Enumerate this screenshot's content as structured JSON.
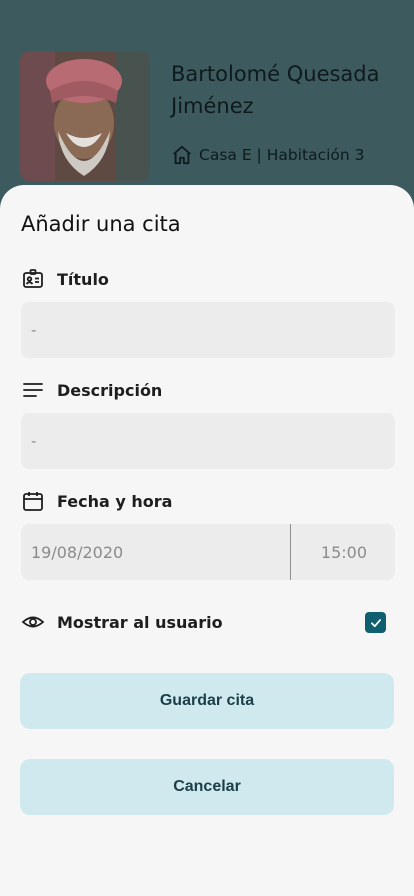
{
  "resident": {
    "name": "Bartolomé Quesada Jiménez",
    "location": "Casa E | Habitación 3"
  },
  "sheet": {
    "title": "Añadir una cita"
  },
  "form": {
    "title_label": "Título",
    "title_value": "-",
    "description_label": "Descripción",
    "description_value": "-",
    "datetime_label": "Fecha y hora",
    "date_value": "19/08/2020",
    "time_value": "15:00",
    "show_user_label": "Mostrar al usuario",
    "show_user_checked": true
  },
  "buttons": {
    "save": "Guardar cita",
    "cancel": "Cancelar"
  },
  "colors": {
    "accent": "#0f5f70",
    "button_bg": "#cfe9ef",
    "overlay": "#3d5a5f"
  },
  "icons": [
    "home-icon",
    "id-card-icon",
    "text-lines-icon",
    "calendar-icon",
    "eye-icon",
    "check-icon"
  ]
}
